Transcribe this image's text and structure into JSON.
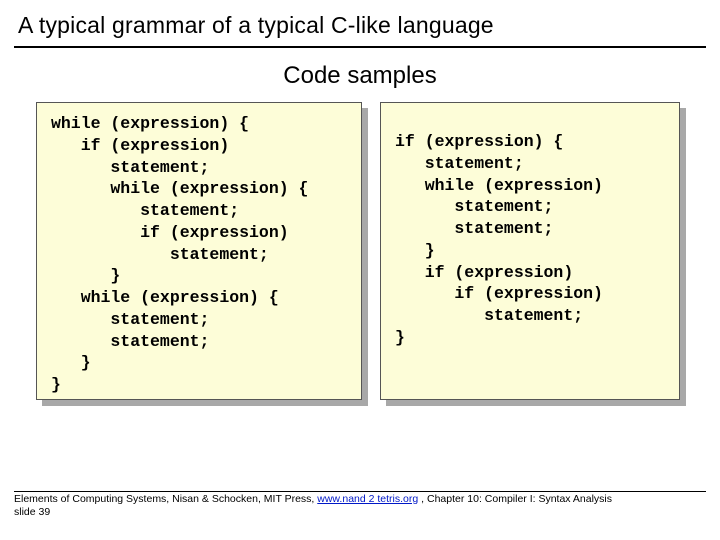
{
  "title": "A typical grammar of a typical C-like language",
  "subtitle": "Code samples",
  "code_left": "while (expression) {\n   if (expression)\n      statement;\n      while (expression) {\n         statement;\n         if (expression)\n            statement;\n      }\n   while (expression) {\n      statement;\n      statement;\n   }\n}",
  "code_right": "if (expression) {\n   statement;\n   while (expression)\n      statement;\n      statement;\n   }\n   if (expression)\n      if (expression)\n         statement;\n}",
  "footer_pre": "Elements of Computing Systems, Nisan & Schocken, MIT Press, ",
  "footer_link": "www.nand 2 tetris.org",
  "footer_post": " , Chapter 10: Compiler I: Syntax Analysis",
  "footer_slide": "slide 39"
}
